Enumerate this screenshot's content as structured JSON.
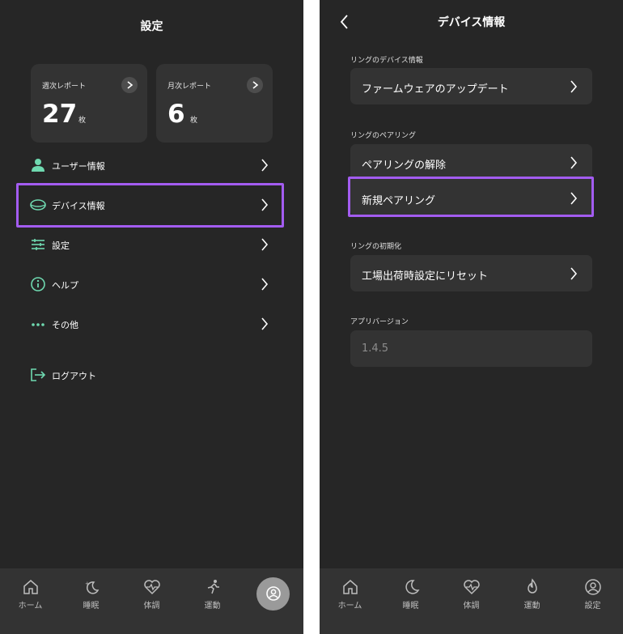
{
  "left": {
    "title": "設定",
    "weekly": {
      "label": "週次レポート",
      "count": "27",
      "unit": "枚"
    },
    "monthly": {
      "label": "月次レポート",
      "count": "6",
      "unit": "枚"
    },
    "menu": [
      {
        "label": "ユーザー情報",
        "icon": "user-icon"
      },
      {
        "label": "デバイス情報",
        "icon": "ring-icon"
      },
      {
        "label": "設定",
        "icon": "sliders-icon"
      },
      {
        "label": "ヘルプ",
        "icon": "info-icon"
      },
      {
        "label": "その他",
        "icon": "more-icon"
      }
    ],
    "logout": "ログアウト",
    "highlight_color": "#a35cf0",
    "accent_color": "#6fd9b0"
  },
  "right": {
    "title": "デバイス情報",
    "sections": [
      {
        "label": "リングのデバイス情報",
        "rows": [
          "ファームウェアのアップデート"
        ]
      },
      {
        "label": "リングのペアリング",
        "rows": [
          "ペアリングの解除",
          "新規ペアリング"
        ]
      },
      {
        "label": "リングの初期化",
        "rows": [
          "工場出荷時設定にリセット"
        ]
      },
      {
        "label": "アプリバージョン",
        "value": "1.4.5"
      }
    ]
  },
  "tabbar": {
    "tabs": [
      {
        "label": "ホーム",
        "icon": "home-icon"
      },
      {
        "label": "睡眠",
        "icon": "moon-icon"
      },
      {
        "label": "体調",
        "icon": "heart-pulse-icon"
      },
      {
        "label": "運動",
        "icon": "runner-icon"
      },
      {
        "label": "設定",
        "icon": "profile-icon"
      }
    ]
  }
}
